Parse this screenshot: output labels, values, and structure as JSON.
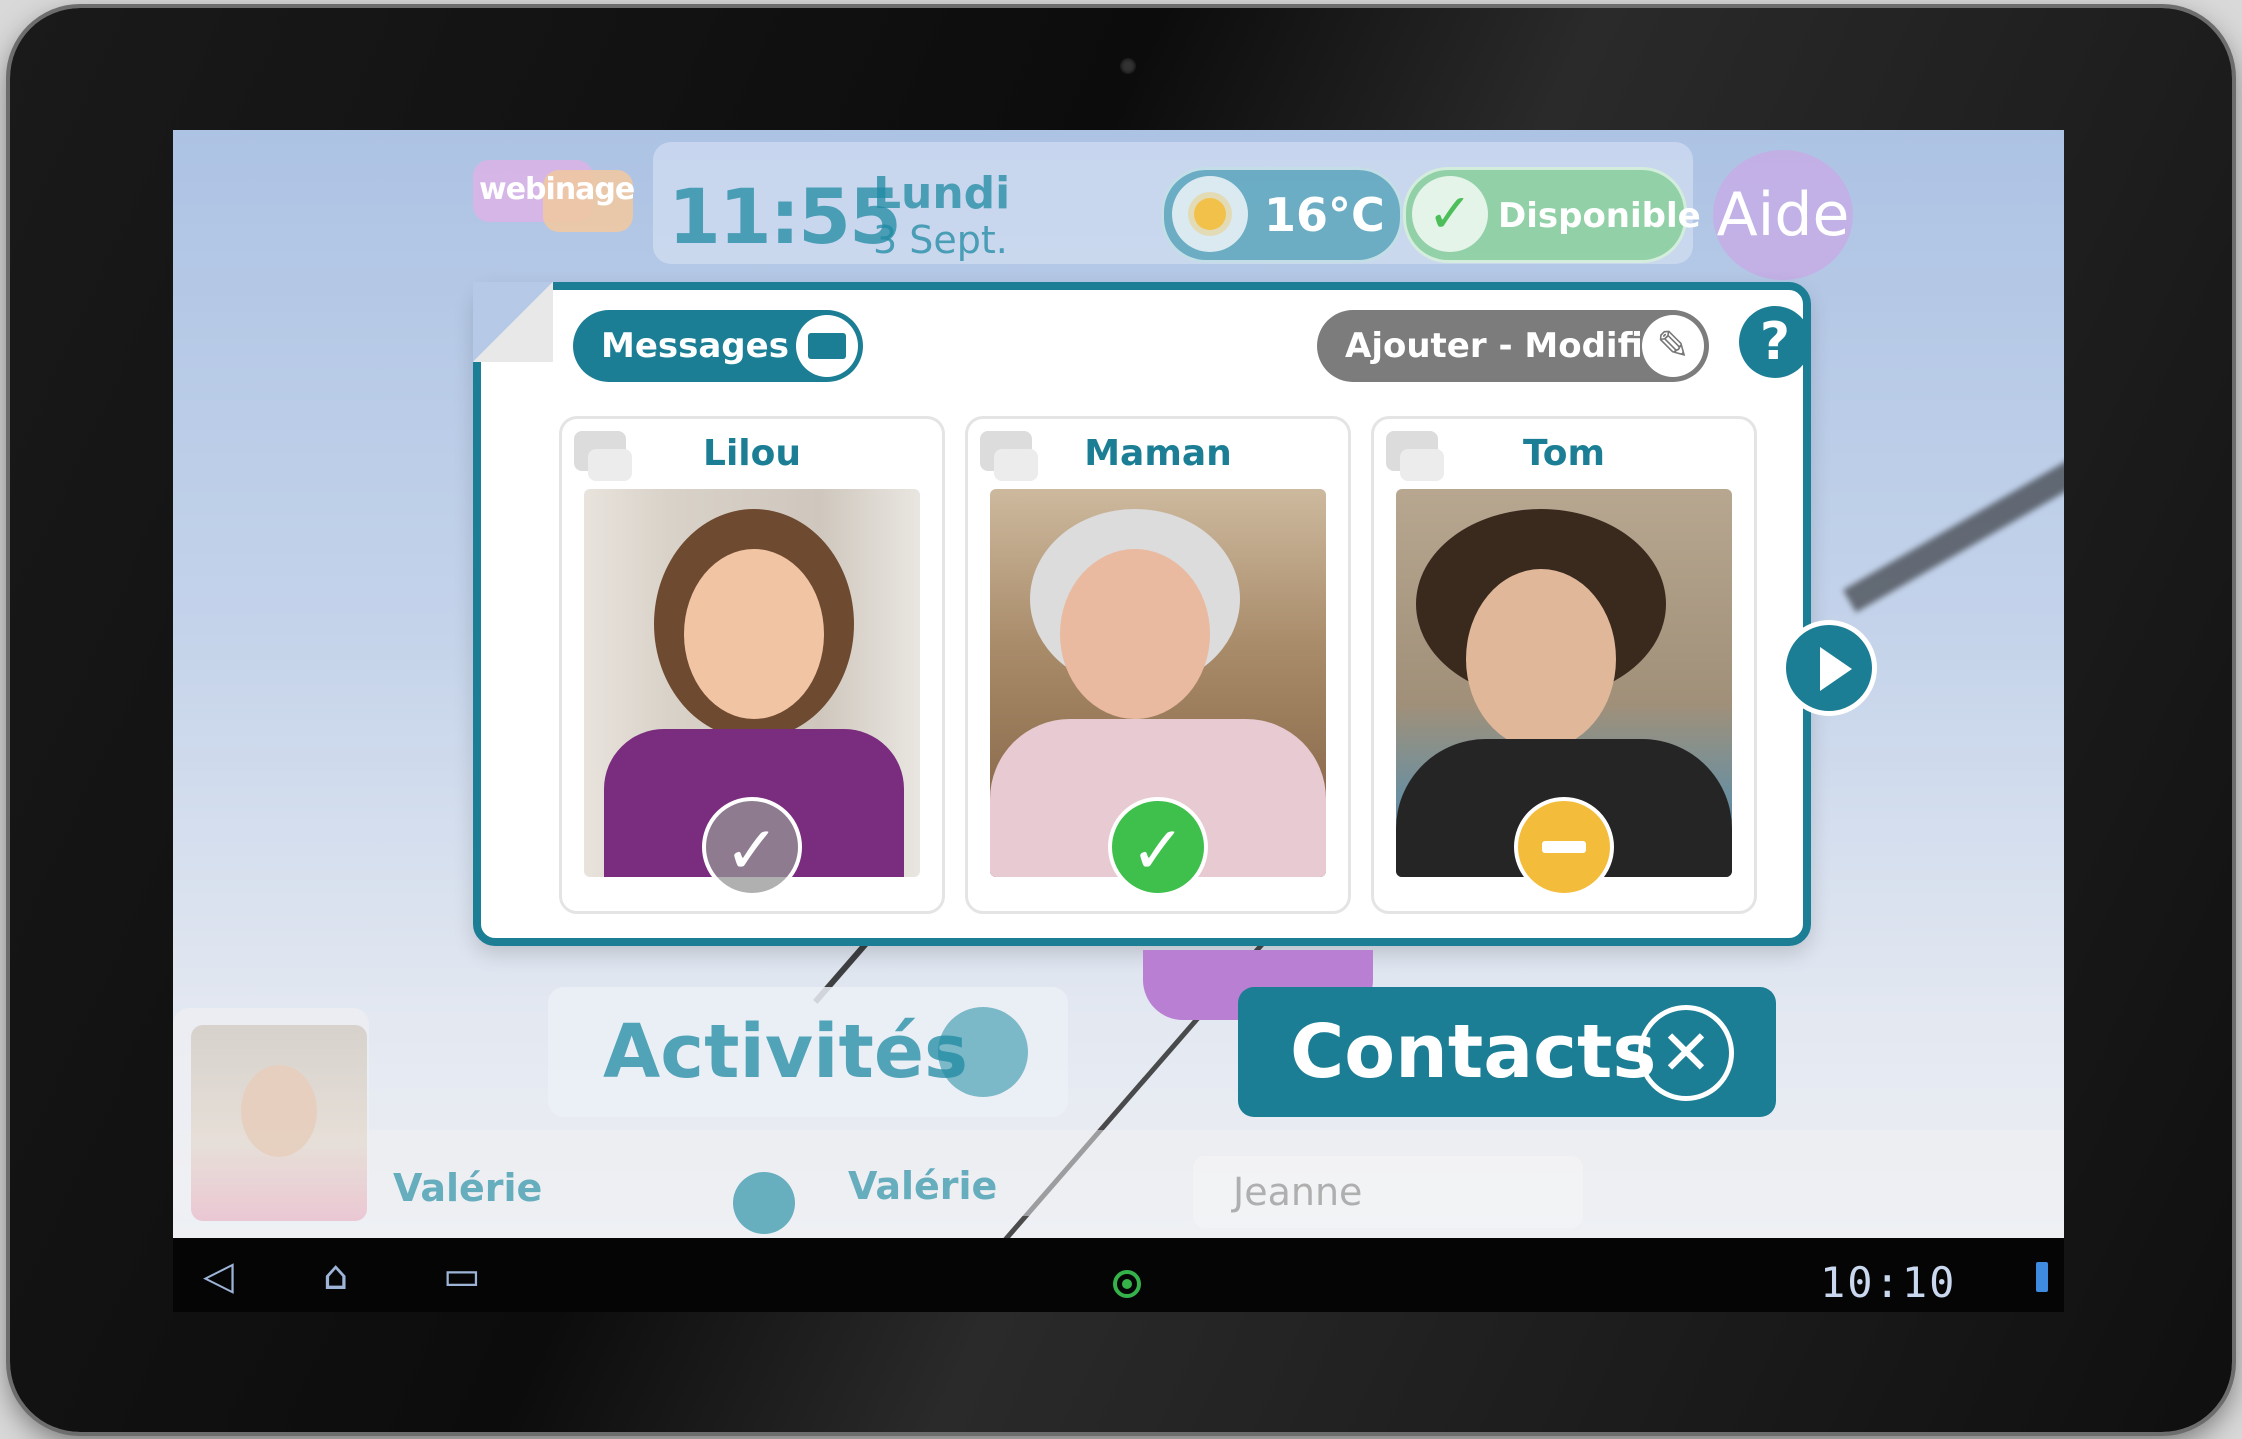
{
  "header": {
    "logo_text": "webinage",
    "time": "11:55",
    "day": "Lundi",
    "date": "3 Sept.",
    "temperature": "16°C",
    "status_label": "Disponible",
    "help_label": "Aide"
  },
  "panel": {
    "messages_label": "Messages",
    "edit_label": "Ajouter - Modifier",
    "help_symbol": "?",
    "contacts": [
      {
        "name": "Lilou",
        "status": "offline",
        "status_icon": "check-icon"
      },
      {
        "name": "Maman",
        "status": "available",
        "status_icon": "check-icon"
      },
      {
        "name": "Tom",
        "status": "busy",
        "status_icon": "minus-icon"
      }
    ]
  },
  "bottom": {
    "activities_label": "Activités",
    "contacts_label": "Contacts",
    "contacts_close_symbol": "✕"
  },
  "users": {
    "current_user": "Valérie",
    "selected_user": "Valérie",
    "next_user": "Jeanne"
  },
  "system": {
    "clock": "10:10"
  },
  "colors": {
    "accent": "#1b7e95",
    "available": "#3fbf4c",
    "busy": "#f3bd3b",
    "offline": "#969696"
  }
}
